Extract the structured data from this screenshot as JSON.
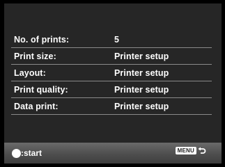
{
  "settings": [
    {
      "label": "No. of prints:",
      "value": "5"
    },
    {
      "label": "Print size:",
      "value": "Printer setup"
    },
    {
      "label": "Layout:",
      "value": "Printer setup"
    },
    {
      "label": "Print quality:",
      "value": "Printer setup"
    },
    {
      "label": "Data print:",
      "value": "Printer setup"
    }
  ],
  "footer": {
    "start_icon": "controller-center-button-icon",
    "start_label": ":start",
    "menu_key_label": "MENU",
    "return_icon": "return-arrow-icon"
  },
  "colors": {
    "background": "#000000",
    "panel": "#262626",
    "text": "#ffffff",
    "divider": "#8a8a8a",
    "footer": "#555555"
  }
}
